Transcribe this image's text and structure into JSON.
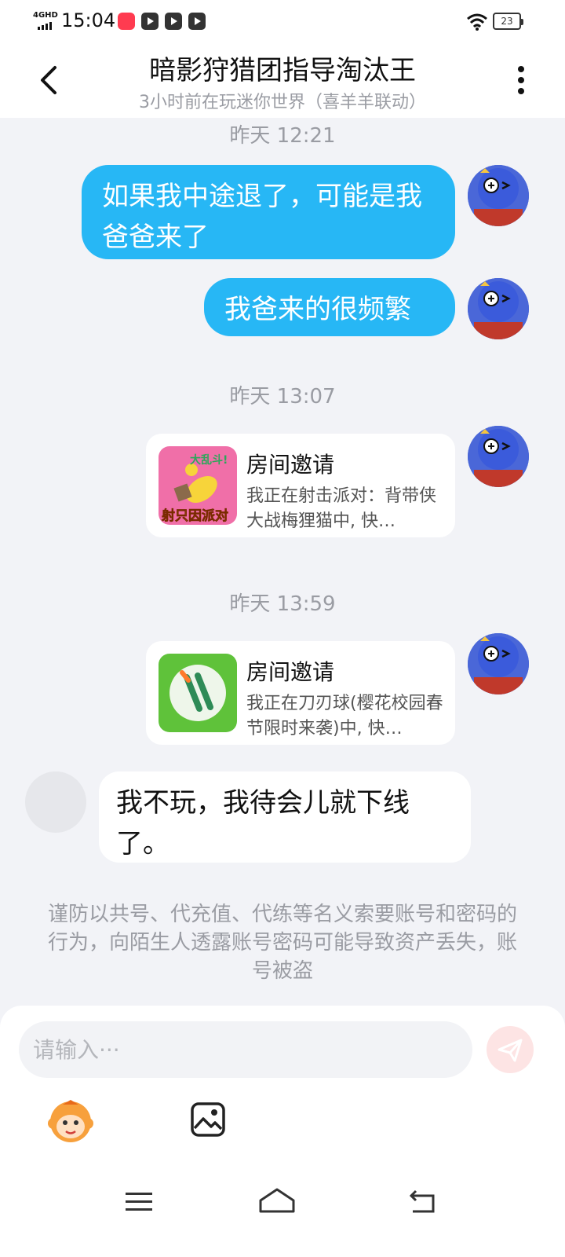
{
  "status_bar": {
    "network": "4GHD",
    "time": "15:04",
    "battery": "23"
  },
  "header": {
    "title": "暗影狩猎团指导淘汰王",
    "subtitle": "3小时前在玩迷你世界（喜羊羊联动）"
  },
  "messages": {
    "time1": "昨天 12:21",
    "msg1": "如果我中途退了，可能是我爸爸来了",
    "msg2": "我爸来的很频繁",
    "time2": "昨天 13:07",
    "card1": {
      "title": "房间邀请",
      "desc": "我正在射击派对：背带侠大战梅狸猫中, 快…",
      "thumb_text_top": "大乱斗!",
      "thumb_text_bottom": "射只因派对"
    },
    "time3": "昨天 13:59",
    "card2": {
      "title": "房间邀请",
      "desc": "我正在刀刃球(樱花校园春节限时来袭)中, 快…"
    },
    "msg3": "我不玩，我待会儿就下线了。"
  },
  "warning": "谨防以共号、代充值、代练等名义索要账号和密码的行为，向陌生人透露账号密码可能导致资产丢失，账号被盗",
  "input": {
    "placeholder": "请输入···",
    "value": ""
  },
  "icons": {
    "back": "chevron-left-icon",
    "more": "more-vertical-icon",
    "send": "send-icon",
    "mascot": "monkey-mascot-icon",
    "image": "image-icon"
  },
  "colors": {
    "accent": "#27b7f5",
    "background": "#f2f3f7",
    "send_button": "#fde4e4"
  }
}
